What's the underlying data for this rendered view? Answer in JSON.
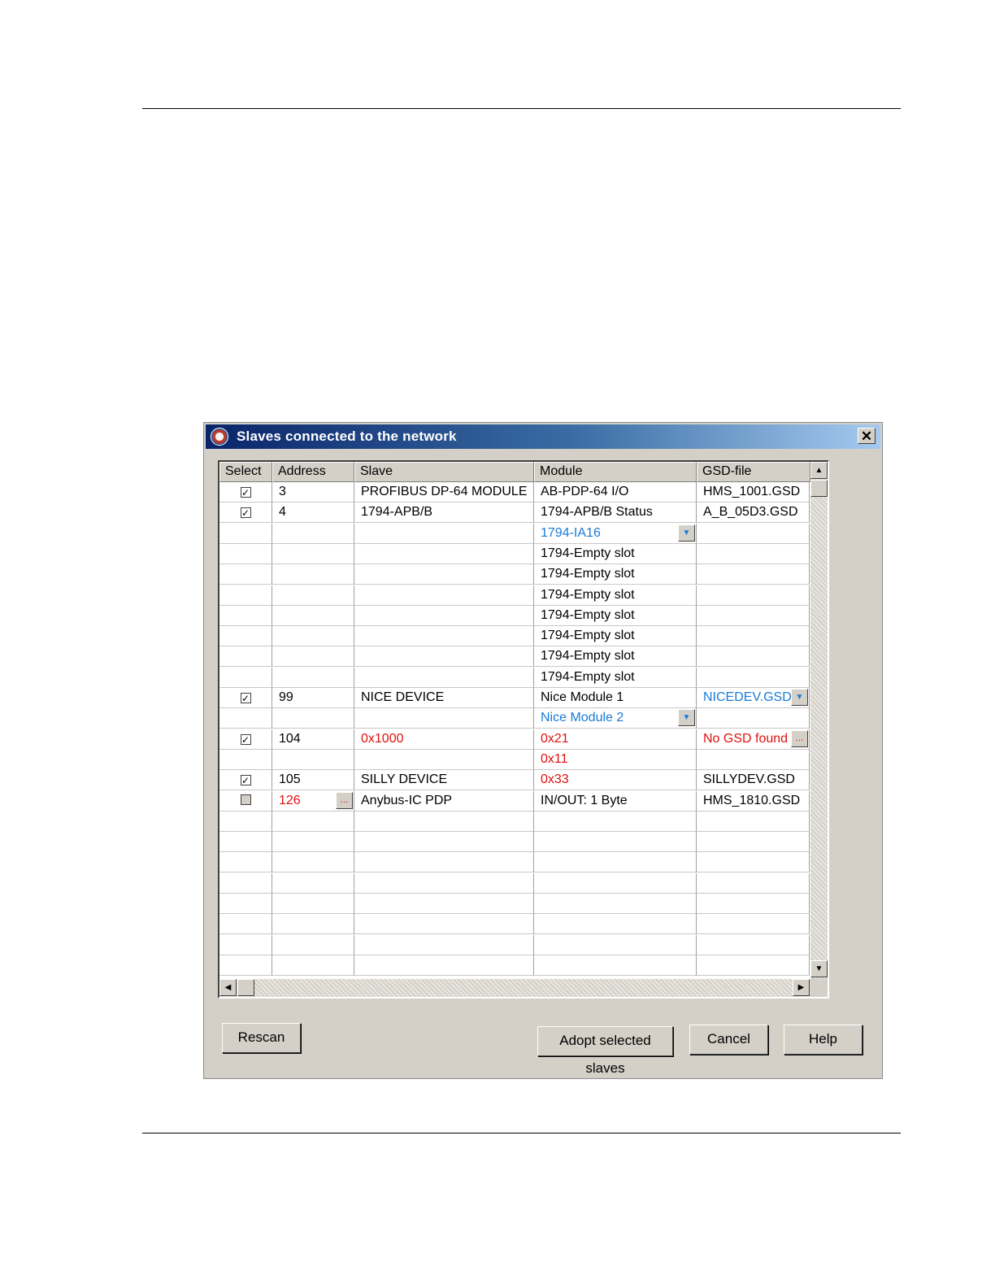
{
  "dialog": {
    "title": "Slaves connected to the network",
    "close_glyph": "✕"
  },
  "table": {
    "headers": [
      "Select",
      "Address",
      "Slave",
      "Module",
      "GSD-file"
    ],
    "rows": [
      {
        "checked": true,
        "address": "3",
        "slave": "PROFIBUS DP-64 MODULE",
        "module": "AB-PDP-64 I/O",
        "gsd": "HMS_1001.GSD"
      },
      {
        "checked": true,
        "address": "4",
        "slave": "1794-APB/B",
        "module": "1794-APB/B Status",
        "gsd": "A_B_05D3.GSD"
      },
      {
        "checked": null,
        "address": "",
        "slave": "",
        "module": "1794-IA16",
        "gsd": "",
        "module_color": "blue",
        "module_dropdown": true
      },
      {
        "checked": null,
        "address": "",
        "slave": "",
        "module": "1794-Empty slot",
        "gsd": ""
      },
      {
        "checked": null,
        "address": "",
        "slave": "",
        "module": "1794-Empty slot",
        "gsd": ""
      },
      {
        "checked": null,
        "address": "",
        "slave": "",
        "module": "1794-Empty slot",
        "gsd": ""
      },
      {
        "checked": null,
        "address": "",
        "slave": "",
        "module": "1794-Empty slot",
        "gsd": ""
      },
      {
        "checked": null,
        "address": "",
        "slave": "",
        "module": "1794-Empty slot",
        "gsd": ""
      },
      {
        "checked": null,
        "address": "",
        "slave": "",
        "module": "1794-Empty slot",
        "gsd": ""
      },
      {
        "checked": null,
        "address": "",
        "slave": "",
        "module": "1794-Empty slot",
        "gsd": ""
      },
      {
        "checked": true,
        "address": "99",
        "slave": "NICE DEVICE",
        "module": "Nice Module 1",
        "gsd": "NICEDEV.GSD",
        "gsd_color": "blue",
        "gsd_dropdown": true
      },
      {
        "checked": null,
        "address": "",
        "slave": "",
        "module": "Nice Module 2",
        "gsd": "",
        "module_color": "blue",
        "module_dropdown": true
      },
      {
        "checked": true,
        "address": "104",
        "slave": "0x1000",
        "module": "0x21",
        "gsd": "No GSD found",
        "slave_color": "red",
        "module_color": "red",
        "gsd_color": "red",
        "gsd_browse": true
      },
      {
        "checked": null,
        "address": "",
        "slave": "",
        "module": "0x11",
        "gsd": "",
        "module_color": "red"
      },
      {
        "checked": true,
        "address": "105",
        "slave": "SILLY DEVICE",
        "module": "0x33",
        "gsd": "SILLYDEV.GSD",
        "module_color": "red"
      },
      {
        "checked": false,
        "address": "126",
        "slave": "Anybus-IC PDP",
        "module": "IN/OUT: 1 Byte",
        "gsd": "HMS_1810.GSD",
        "address_color": "red",
        "address_browse": true
      },
      {
        "checked": null,
        "address": "",
        "slave": "",
        "module": "",
        "gsd": ""
      },
      {
        "checked": null,
        "address": "",
        "slave": "",
        "module": "",
        "gsd": ""
      },
      {
        "checked": null,
        "address": "",
        "slave": "",
        "module": "",
        "gsd": ""
      },
      {
        "checked": null,
        "address": "",
        "slave": "",
        "module": "",
        "gsd": ""
      },
      {
        "checked": null,
        "address": "",
        "slave": "",
        "module": "",
        "gsd": ""
      },
      {
        "checked": null,
        "address": "",
        "slave": "",
        "module": "",
        "gsd": ""
      },
      {
        "checked": null,
        "address": "",
        "slave": "",
        "module": "",
        "gsd": ""
      },
      {
        "checked": null,
        "address": "",
        "slave": "",
        "module": "",
        "gsd": ""
      }
    ]
  },
  "glyphs": {
    "check": "✓",
    "dropdown": "▼",
    "browse": "...",
    "scroll_up": "▲",
    "scroll_down": "▼",
    "scroll_left": "◀",
    "scroll_right": "▶"
  },
  "buttons": {
    "rescan": "Rescan",
    "adopt": "Adopt selected slaves",
    "cancel": "Cancel",
    "help": "Help"
  },
  "colors": {
    "red": "#e01010",
    "blue": "#1a7ad6"
  }
}
